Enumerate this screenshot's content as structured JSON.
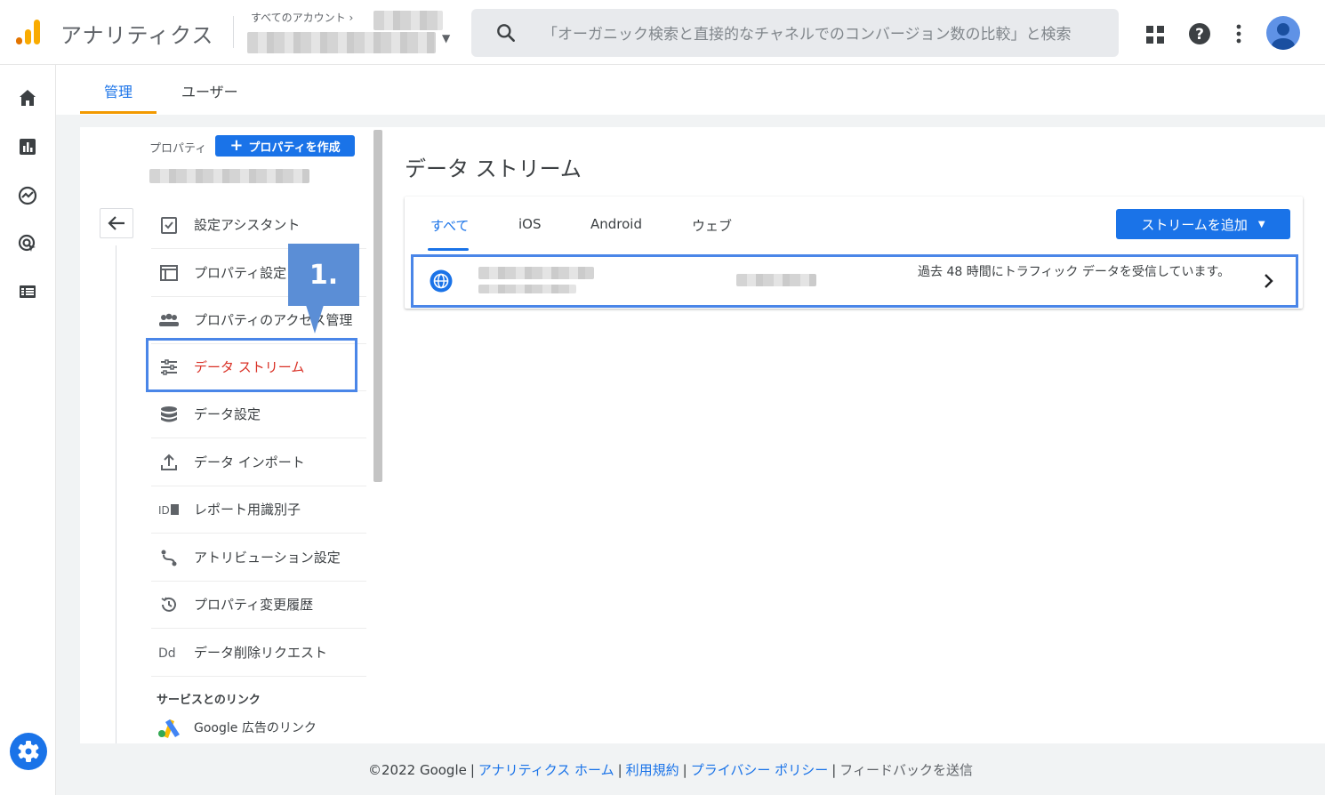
{
  "header": {
    "app_title": "アナリティクス",
    "account_breadcrumb": "すべてのアカウント ›",
    "search_placeholder": "「オーガニック検索と直接的なチャネルでのコンバージョン数の比較」と検索",
    "icons": [
      "search-icon",
      "apps-icon",
      "help-icon",
      "more-vert-icon",
      "avatar-icon"
    ]
  },
  "rail": {
    "icons": [
      "home-icon",
      "reports-icon",
      "explore-icon",
      "advertising-icon",
      "configure-icon",
      "admin-gear-icon"
    ]
  },
  "tabs": {
    "admin": "管理",
    "user": "ユーザー"
  },
  "property_nav": {
    "property_label": "プロパティ",
    "create_property": "プロパティを作成",
    "items": [
      {
        "label": "設定アシスタント",
        "icon": "checklist-icon"
      },
      {
        "label": "プロパティ設定",
        "icon": "property-settings-icon"
      },
      {
        "label": "プロパティのアクセス管理",
        "icon": "people-icon"
      },
      {
        "label": "データ ストリーム",
        "icon": "data-stream-icon"
      },
      {
        "label": "データ設定",
        "icon": "database-icon"
      },
      {
        "label": "データ インポート",
        "icon": "upload-icon"
      },
      {
        "label": "レポート用識別子",
        "icon": "identity-icon"
      },
      {
        "label": "アトリビューション設定",
        "icon": "attribution-icon"
      },
      {
        "label": "プロパティ変更履歴",
        "icon": "history-icon"
      },
      {
        "label": "データ削除リクエスト",
        "icon": "dd-icon"
      }
    ],
    "services_heading": "サービスとのリンク",
    "google_ads_link": "Google 広告のリンク",
    "callout": "1."
  },
  "data_streams": {
    "title": "データ ストリーム",
    "tabs": [
      "すべて",
      "iOS",
      "Android",
      "ウェブ"
    ],
    "add_stream": "ストリームを追加",
    "stream_status": "過去 48 時間にトラフィック データを受信しています。"
  },
  "footer": {
    "copyright": "©2022 Google",
    "links": [
      "アナリティクス ホーム",
      "利用規約",
      "プライバシー ポリシー"
    ],
    "feedback": "フィードバックを送信"
  },
  "colors": {
    "accent_blue": "#1a73e8",
    "active_red": "#d93025",
    "tab_orange": "#f29900",
    "highlight_blue": "#4a86e8"
  }
}
